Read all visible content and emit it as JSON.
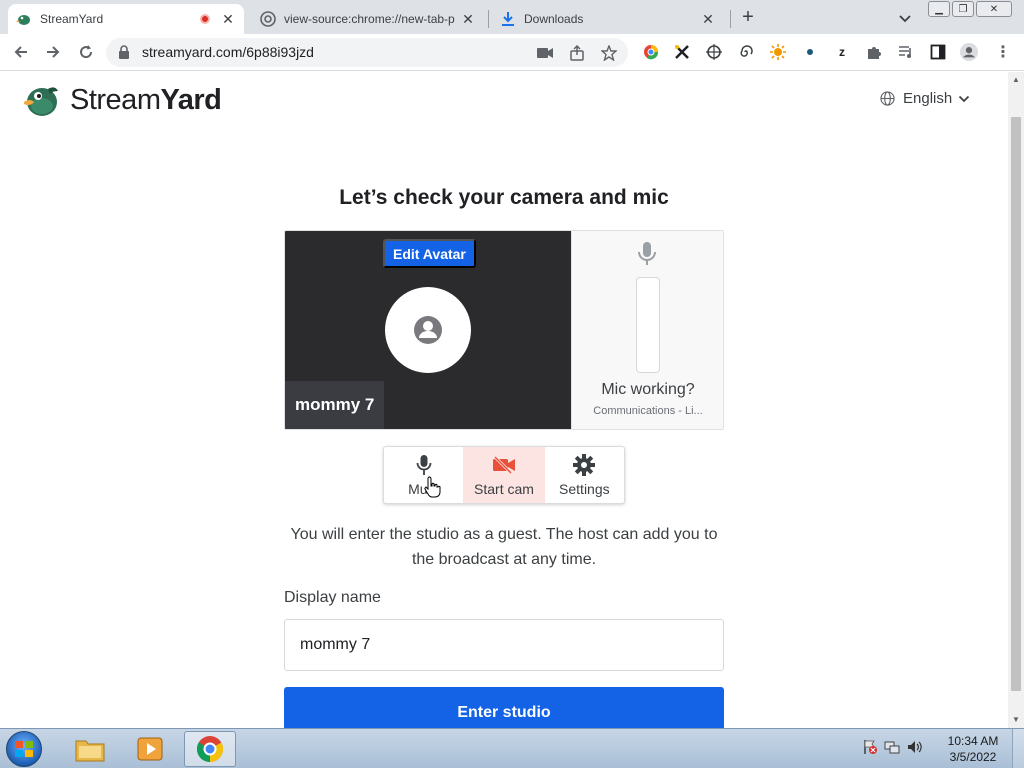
{
  "browser": {
    "tabs": [
      {
        "title": "StreamYard",
        "recording": true
      },
      {
        "title": "view-source:chrome://new-tab-p"
      },
      {
        "title": "Downloads"
      }
    ],
    "url": "streamyard.com/6p88i93jzd"
  },
  "page": {
    "logo": {
      "text_light": "Stream",
      "text_bold": "Yard"
    },
    "language": "English",
    "heading": "Let’s check your camera and mic",
    "preview": {
      "edit_avatar_label": "Edit Avatar",
      "participant_name": "mommy 7",
      "mic_prompt": "Mic working?",
      "mic_device": "Communications - Li...",
      "mic_level": 0
    },
    "controls": [
      {
        "label": "Mute",
        "icon": "microphone-icon"
      },
      {
        "label": "Start cam",
        "icon": "camera-off-icon"
      },
      {
        "label": "Settings",
        "icon": "gear-icon"
      }
    ],
    "notice": "You will enter the studio as a guest. The host can add you to the broadcast at any time.",
    "display_name_label": "Display name",
    "display_name_value": "mommy 7",
    "enter_button": "Enter studio"
  },
  "taskbar": {
    "time": "10:34 AM",
    "date": "3/5/2022"
  },
  "colors": {
    "brand_blue": "#1463e6",
    "video_bg": "#2b2b2e",
    "cam_off_bg": "#fbe4e1",
    "cam_off_icon": "#e8503a"
  }
}
